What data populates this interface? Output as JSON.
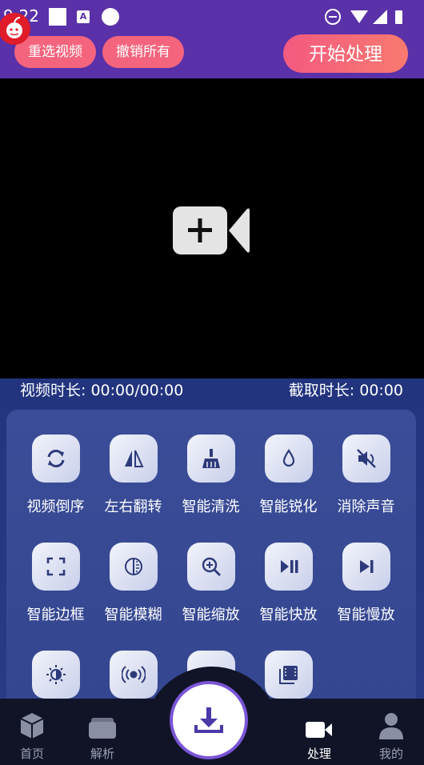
{
  "status_bar": {
    "time": "9:22",
    "badge_a": "A"
  },
  "toolbar": {
    "reselect_label": "重选视频",
    "undo_label": "撤销所有",
    "start_label": "开始处理"
  },
  "durations": {
    "video_duration": "视频时长: 00:00/00:00",
    "clip_duration": "截取时长: 00:00"
  },
  "tools": [
    {
      "label": "视频倒序",
      "icon": "refresh-icon"
    },
    {
      "label": "左右翻转",
      "icon": "flip-horizontal-icon"
    },
    {
      "label": "智能清洗",
      "icon": "broom-icon"
    },
    {
      "label": "智能锐化",
      "icon": "droplet-icon"
    },
    {
      "label": "消除声音",
      "icon": "mute-icon"
    },
    {
      "label": "智能边框",
      "icon": "frame-corners-icon"
    },
    {
      "label": "智能模糊",
      "icon": "blur-icon"
    },
    {
      "label": "智能缩放",
      "icon": "zoom-in-icon"
    },
    {
      "label": "智能快放",
      "icon": "play-pause-icon"
    },
    {
      "label": "智能慢放",
      "icon": "skip-next-icon"
    },
    {
      "label": "",
      "icon": "contrast-icon"
    },
    {
      "label": "",
      "icon": "broadcast-icon"
    },
    {
      "label": "",
      "icon": "sparkle-icon"
    },
    {
      "label": "",
      "icon": "film-library-icon"
    }
  ],
  "nav": [
    {
      "label": "首页",
      "icon": "cube-icon"
    },
    {
      "label": "解析",
      "icon": "wallet-icon"
    },
    {
      "label": "处理",
      "icon": "video-camera-icon"
    },
    {
      "label": "我的",
      "icon": "person-icon"
    }
  ],
  "colors": {
    "accent": "#5a31a8",
    "pill": "#f4647d",
    "panel": "#2a3b86",
    "nav_bg": "#111427"
  }
}
